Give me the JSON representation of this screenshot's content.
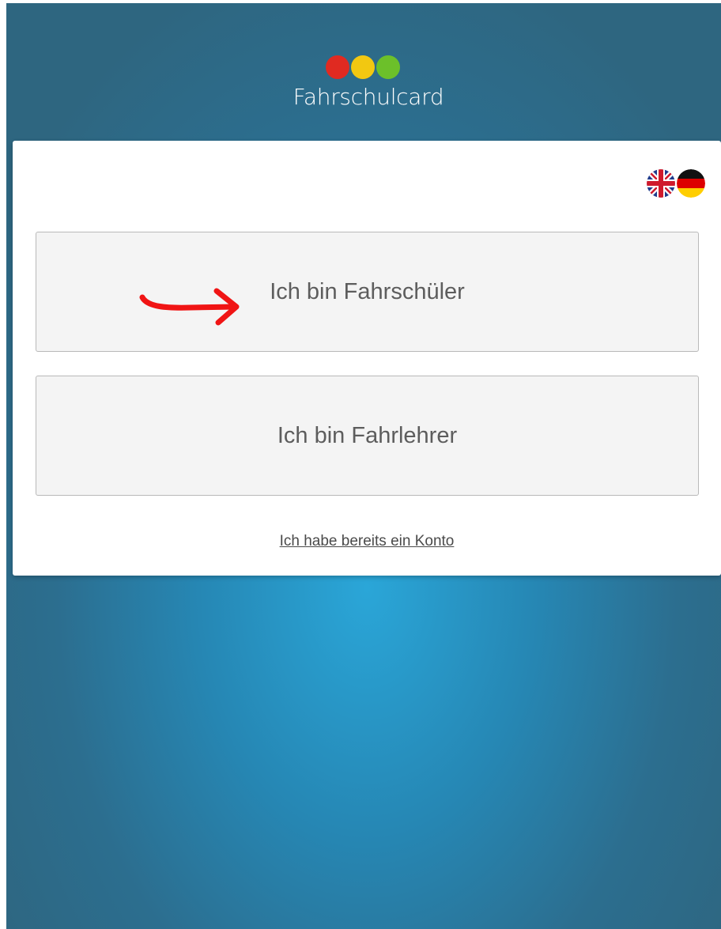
{
  "brand": {
    "name": "Fahrschulcard",
    "dot_colors": [
      "#e02a21",
      "#f2c811",
      "#6cc02a"
    ]
  },
  "language": {
    "options": [
      {
        "code": "en",
        "icon": "uk-flag-icon"
      },
      {
        "code": "de",
        "icon": "german-flag-icon"
      }
    ]
  },
  "choices": {
    "student_label": "Ich bin Fahrschüler",
    "teacher_label": "Ich bin Fahrlehrer"
  },
  "links": {
    "existing_account": "Ich habe bereits ein Konto"
  },
  "annotation": {
    "icon": "arrow-icon",
    "color": "#f01414"
  },
  "colors": {
    "background": "#2a7fa6",
    "card": "#ffffff",
    "button_bg": "#f4f4f4"
  }
}
